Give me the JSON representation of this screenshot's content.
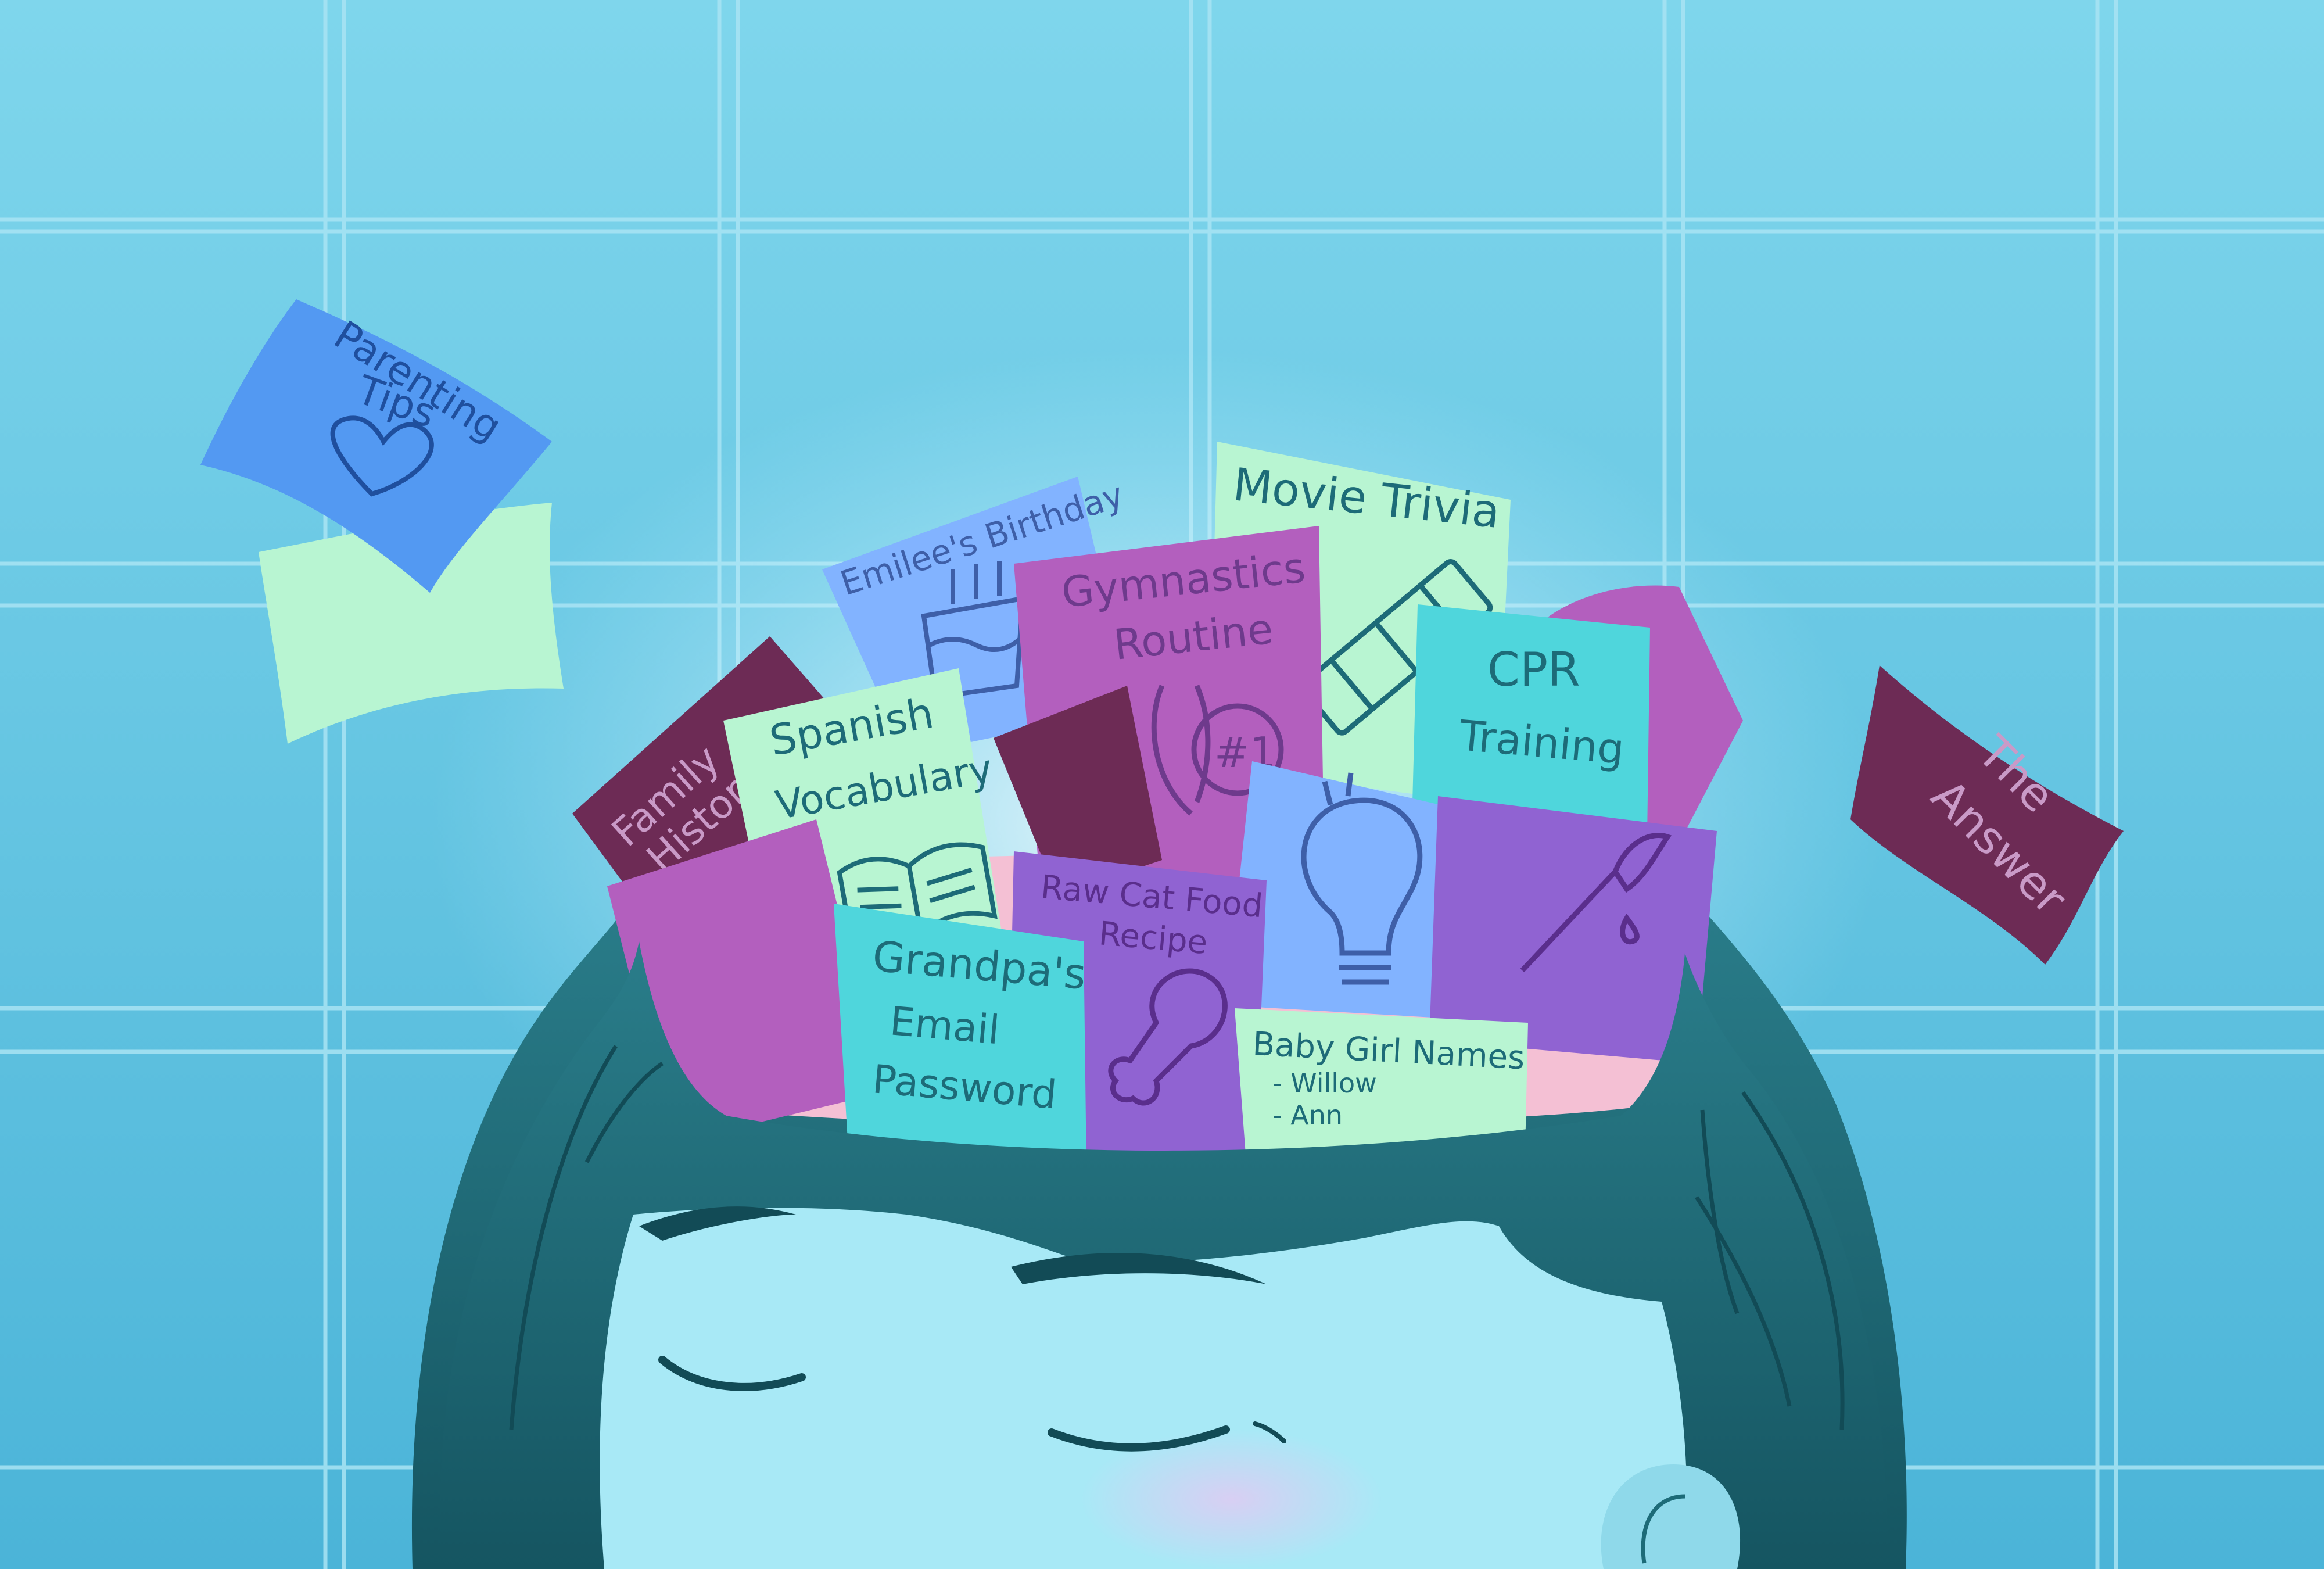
{
  "palette": {
    "background_top": "#7fd6ec",
    "background_bottom": "#4bb4d8",
    "grid_line": "#a9e4f4",
    "skin": "#a8e9f6",
    "hair": "#1c6673",
    "hair_dark": "#124b56",
    "scalp_inner": "#f4c0d4",
    "note_mint": "#b8f5d2",
    "note_blue": "#6fa8ff",
    "note_periwinkle": "#82b3ff",
    "note_magenta": "#b35fbe",
    "note_plum": "#6d2b55",
    "note_purple": "#9063d2",
    "note_teal": "#4fd6dc",
    "ink_teal": "#1d6b78",
    "ink_purple": "#6e3a8c"
  },
  "notes": {
    "parenting": {
      "line1": "Parenting",
      "line2": "Tips",
      "icon": "heart-icon"
    },
    "answer": {
      "line1": "The",
      "line2": "Answer"
    },
    "movie": {
      "label": "Movie Trivia",
      "icon": "film-strip-icon"
    },
    "birthday": {
      "label": "Emilee's Birthday",
      "icon": "birthday-cake-icon"
    },
    "gymnastics": {
      "line1": "Gymnastics",
      "line2": "Routine",
      "icon": "medal-icon",
      "medal_text": "#1"
    },
    "cpr": {
      "line1": "CPR",
      "line2": "Training"
    },
    "family": {
      "line1": "Family",
      "line2": "History"
    },
    "spanish": {
      "line1": "Spanish",
      "line2": "Vocabulary",
      "icon": "open-book-icon"
    },
    "catfood": {
      "line1": "Raw Cat Food",
      "line2": "Recipe",
      "icon": "drumstick-icon"
    },
    "idea": {
      "icon": "light-bulb-icon"
    },
    "art": {
      "icon": "paintbrush-icon"
    },
    "grandpa": {
      "line1": "Grandpa's",
      "line2": "Email",
      "line3": "Password"
    },
    "baby": {
      "title": "Baby Girl Names",
      "item1": "- Willow",
      "item2": "- Ann"
    }
  }
}
